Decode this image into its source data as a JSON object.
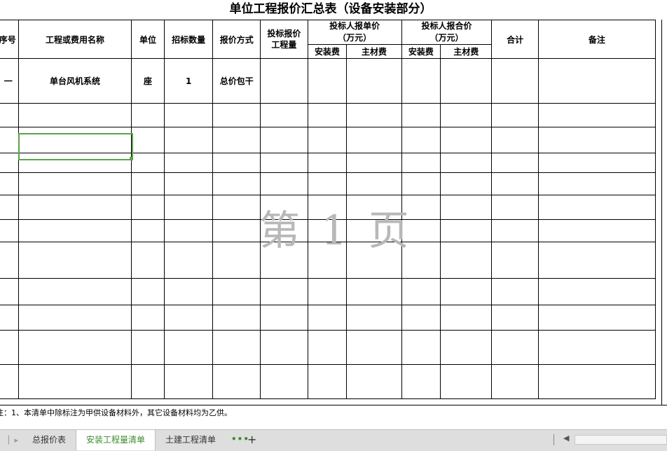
{
  "sheet": {
    "title": "单位工程报价汇总表（设备安装部分）",
    "headers": {
      "seq": "序号",
      "name": "工程或费用名称",
      "unit": "单位",
      "bid_qty": "招标数量",
      "quote_method": "报价方式",
      "bid_quote_qty_line1": "投标报价",
      "bid_quote_qty_line2": "工程量",
      "unit_price_line1": "投标人报单价",
      "unit_price_line2": "（万元）",
      "total_price_line1": "投标人报合价",
      "total_price_line2": "（万元）",
      "total": "合计",
      "remark": "备注",
      "install_fee": "安装费",
      "material_fee": "主材费",
      "install_fee_2": "安装费",
      "material_fee_2": "主材费"
    },
    "rows": [
      {
        "seq": "一",
        "name": "单台风机系统",
        "unit": "座",
        "qty": "1",
        "method": "总价包干"
      }
    ],
    "watermark": "第 1 页",
    "note": "注：1、本清单中除标注为甲供设备材料外，其它设备材料均为乙供。"
  },
  "tabbar": {
    "tabs": [
      "总报价表",
      "安装工程量清单",
      "土建工程清单"
    ],
    "active_tab": "安装工程量清单",
    "more": "•••",
    "add": "+",
    "accent_color": "#3d8b2f"
  }
}
